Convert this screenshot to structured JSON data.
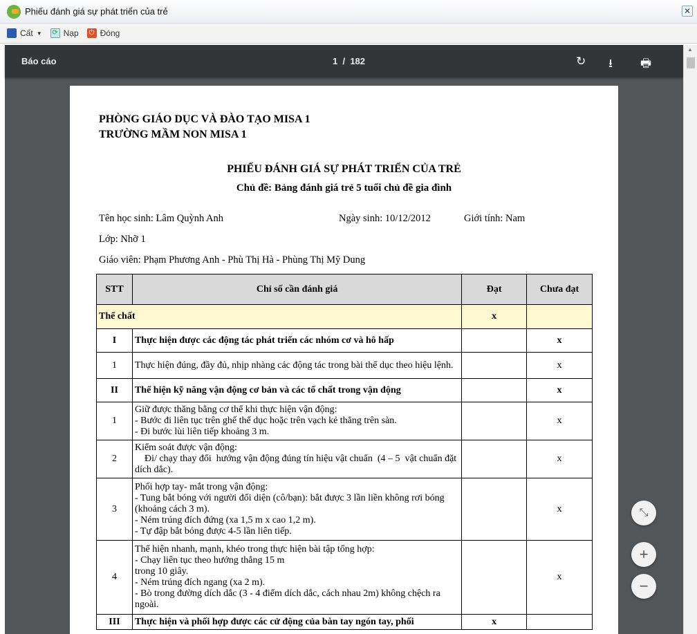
{
  "window": {
    "title": "Phiếu đánh giá sự phát triển của trẻ",
    "close": "✕"
  },
  "toolbar": {
    "save": "Cất",
    "reload": "Nạp",
    "close": "Đóng"
  },
  "viewer": {
    "title": "Báo cáo",
    "page": "1",
    "total": "182",
    "page_sep": "/"
  },
  "doc": {
    "org1": "PHÒNG GIÁO DỤC VÀ ĐÀO TẠO MISA 1",
    "org2": "TRƯỜNG MẦM NON MISA 1",
    "title": "PHIẾU ĐÁNH GIÁ SỰ PHÁT TRIỂN CỦA TRẺ",
    "subtitle": "Chủ đề: Bảng đánh giá trẻ 5 tuổi chủ đề gia đình",
    "student": "Tên học sinh: Lâm Quỳnh Anh",
    "dob": "Ngày sinh: 10/12/2012",
    "gender": "Giới tính: Nam",
    "class": "Lớp: Nhỡ 1",
    "teacher": "Giáo viên: Phạm Phương Anh - Phù Thị Hà - Phùng Thị Mỹ Dung",
    "headers": [
      "STT",
      "Chỉ số cần đánh giá",
      "Đạt",
      "Chưa đạt"
    ],
    "section": {
      "label": "Thể chất",
      "dat": "x",
      "chua": ""
    },
    "rows": [
      {
        "stt": "I",
        "text": "Thực hiện được các động tác phát triển các nhóm cơ và hô hấp",
        "dat": "",
        "chua": "x",
        "bold": true
      },
      {
        "stt": "1",
        "text": "Thực hiện đúng, đầy đủ, nhịp nhàng các động tác trong bài thể dục theo hiệu lệnh.",
        "dat": "",
        "chua": "x"
      },
      {
        "stt": "II",
        "text": "Thể hiện kỹ năng vận động cơ bản và các tố chất trong vận động",
        "dat": "",
        "chua": "x",
        "bold": true
      },
      {
        "stt": "1",
        "text": "Giữ được thăng bằng cơ thể khi thực hiện vận động:\n- Bước đi liên tục trên ghế thể dục hoặc trên vạch kẻ thẳng trên sàn.\n- Đi bước lùi liên tiếp khoảng 3 m.",
        "dat": "",
        "chua": "x"
      },
      {
        "stt": "2",
        "text": "Kiểm soát được vận động:\n    Đi/ chạy thay đổi  hướng vận động đúng tín hiệu vật chuẩn  (4 – 5  vật chuẩn đặt dích dắc).",
        "dat": "",
        "chua": "x"
      },
      {
        "stt": "3",
        "text": "Phối hợp tay- mắt trong vận động:\n- Tung bắt bóng với người đối diện (cô/bạn): bắt được 3 lần liền không rơi bóng (khoảng cách 3 m).\n- Ném trúng đích đứng (xa 1,5 m x cao 1,2 m).\n- Tự đập bắt bóng được 4-5 lần liên tiếp.",
        "dat": "",
        "chua": "x"
      },
      {
        "stt": "4",
        "text": "Thể hiện nhanh, mạnh, khéo trong thực hiện bài tập tổng hợp:\n- Chạy liên tục theo hướng thẳng 15 m\ntrong 10 giây.\n- Ném trúng đích ngang (xa 2 m).\n- Bò trong đường dích dắc (3 - 4 điểm dích dắc, cách nhau 2m) không chệch ra ngoài.",
        "dat": "",
        "chua": "x"
      },
      {
        "stt": "III",
        "text": "Thực hiện và phối hợp được các cử động của bàn tay ngón tay, phối",
        "dat": "x",
        "chua": "",
        "bold": true
      }
    ]
  },
  "colors": {
    "section_bg": "#fff8d0",
    "viewer_bar": "#323639",
    "viewer_bg": "#525659"
  }
}
